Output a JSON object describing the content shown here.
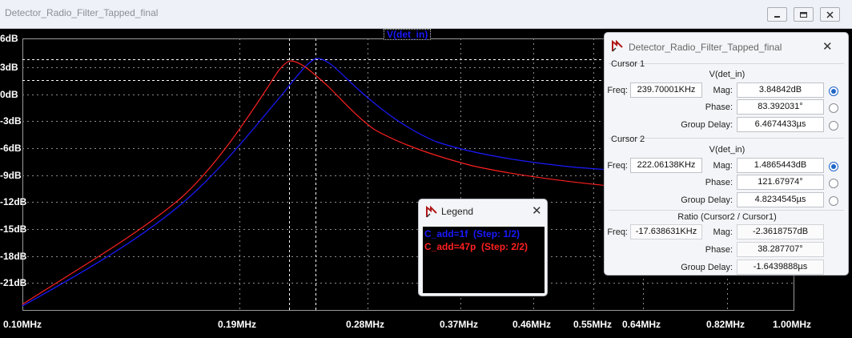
{
  "window": {
    "title": "Detector_Radio_Filter_Tapped_final"
  },
  "plot": {
    "trace_name": "V(det_in)",
    "y_tick_labels": [
      "6dB",
      "3dB",
      "0dB",
      "-3dB",
      "-6dB",
      "-9dB",
      "-12dB",
      "-15dB",
      "-18dB",
      "-21dB"
    ],
    "x_tick_labels": [
      "0.10MHz",
      "0.19MHz",
      "0.28MHz",
      "0.37MHz",
      "0.46MHz",
      "0.55MHz",
      "0.64MHz",
      "0.82MHz",
      "1.00MHz"
    ],
    "colors": {
      "series1": "#1a1aff",
      "series2": "#ff2020",
      "grid": "#8a8a8a",
      "background": "#000000"
    }
  },
  "legend": {
    "title": "Legend",
    "entries": [
      {
        "text": "C_add=1f  (Step: 1/2)",
        "color": "#1a1aff"
      },
      {
        "text": "C_add=47p  (Step: 2/2)",
        "color": "#ff2020"
      }
    ]
  },
  "cursors": {
    "title": "Detector_Radio_Filter_Tapped_final",
    "cursor1": {
      "label": "Cursor 1",
      "trace": "V(det_in)",
      "freq_label": "Freq:",
      "freq": "239.70001KHz",
      "mag_label": "Mag:",
      "mag": "3.84842dB",
      "phase_label": "Phase:",
      "phase": "83.392031°",
      "gd_label": "Group Delay:",
      "gd": "6.4674433µs"
    },
    "cursor2": {
      "label": "Cursor 2",
      "trace": "V(det_in)",
      "freq_label": "Freq:",
      "freq": "222.06138KHz",
      "mag_label": "Mag:",
      "mag": "1.4865443dB",
      "phase_label": "Phase:",
      "phase": "121.67974°",
      "gd_label": "Group Delay:",
      "gd": "4.8234545µs"
    },
    "ratio": {
      "label": "Ratio (Cursor2 / Cursor1)",
      "freq_label": "Freq:",
      "freq": "-17.638631KHz",
      "mag_label": "Mag:",
      "mag": "-2.3618757dB",
      "phase_label": "Phase:",
      "phase": "38.287707°",
      "gd_label": "Group Delay:",
      "gd": "-1.6439888µs"
    }
  },
  "icons": [
    "probe-icon",
    "minimize-icon",
    "restore-icon",
    "close-icon"
  ]
}
